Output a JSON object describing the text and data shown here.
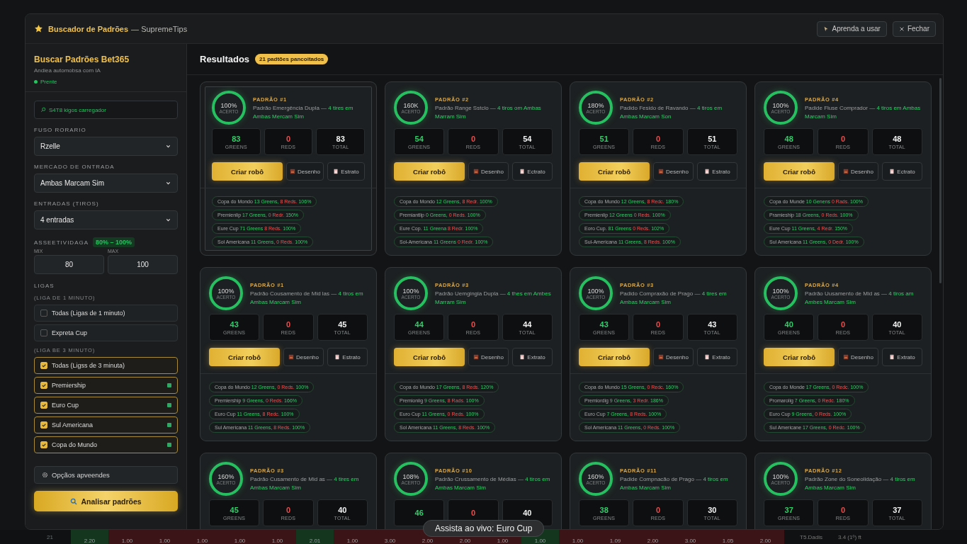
{
  "window": {
    "title": "Buscador de Padrões",
    "subtitle": "— SupremeTips",
    "buttons": [
      {
        "kind": "help",
        "label": "Aprenda a usar"
      },
      {
        "kind": "close",
        "label": "Fechar"
      }
    ]
  },
  "sidebar": {
    "title": "Buscar Padrões Bet365",
    "subtitle": "Andiea automobsa com IA",
    "status": "Prente",
    "info": "S4T8 kigos carregador",
    "fields": [
      {
        "label": "FUSO RORARIO",
        "value": "Rzelle"
      },
      {
        "label": "MERCADO DE ONTRADA",
        "value": "Ambas Marcam Sim"
      },
      {
        "label": "ENTRADAS (TIROS)",
        "value": "4 entradas"
      }
    ],
    "accuracy": {
      "label": "ASSEETIVIDAGA",
      "badge": "80% – 100%",
      "min_label": "MIX",
      "min": "80",
      "max_label": "MAX",
      "max": "100"
    },
    "leagues_title": "LIGAS",
    "groups": [
      {
        "title": "(LIGA DE 1 MINUTO)",
        "items": [
          {
            "label": "Todas (Ligas de 1 minuto)",
            "checked": false,
            "live": false
          },
          {
            "label": "Expreta Cup",
            "checked": false,
            "live": false
          }
        ]
      },
      {
        "title": "(LIGA BE 3 MINUTO)",
        "items": [
          {
            "label": "Todas (Ligss de 3 minuta)",
            "checked": true,
            "live": false
          },
          {
            "label": "Premiership",
            "checked": true,
            "live": true
          },
          {
            "label": "Euro Cup",
            "checked": true,
            "live": true
          },
          {
            "label": "Sul Americana",
            "checked": true,
            "live": true
          },
          {
            "label": "Copa do Mundo",
            "checked": true,
            "live": true
          }
        ]
      }
    ],
    "advanced": "Opçãos apveendes",
    "analyze": "Analisar padrões"
  },
  "results": {
    "title": "Resultados",
    "badge": "21 padtões pancoitados",
    "cards": [
      {
        "title": "PADRÃO #1",
        "selected": true,
        "score": "100%",
        "score_label": "ACERTO",
        "description": "Padrão Emergência Dupla",
        "market": "— 4 tires em Ambas Mercam Sim",
        "stats": [
          {
            "kind": "greens",
            "value": "83",
            "label": "GREENS"
          },
          {
            "kind": "reds",
            "value": "0",
            "label": "REDS"
          },
          {
            "kind": "total",
            "value": "83",
            "label": "TOTAL"
          }
        ],
        "actions": [
          {
            "kind": "primary",
            "label": "Criar robô"
          },
          {
            "kind": "drawing",
            "label": "Desenho"
          },
          {
            "kind": "statement",
            "label": "Estrato"
          }
        ],
        "leagues": [
          {
            "name": "Copa do Mondo",
            "greens": "13 Greens,",
            "reds": "8 Reds.",
            "rate": "106%"
          },
          {
            "name": "Premienlip",
            "greens": "17 Greens,",
            "reds": "0 Redr.",
            "rate": "150%"
          },
          {
            "name": "Eure Cup",
            "greens": "71 Greens",
            "reds": "8 Reds.",
            "rate": "100%"
          },
          {
            "name": "Sol Americana",
            "greens": "11 Greens,",
            "reds": "0 Reds.",
            "rate": "100%"
          }
        ]
      },
      {
        "title": "PADRÃO #2",
        "selected": false,
        "score": "160K",
        "score_label": "ACERTO",
        "description": "Padrão Range Sstclo",
        "market": "— 4 tiros om Ambas Marram Sim",
        "stats": [
          {
            "kind": "greens",
            "value": "54",
            "label": "GREENS"
          },
          {
            "kind": "reds",
            "value": "0",
            "label": "REDS"
          },
          {
            "kind": "total",
            "value": "54",
            "label": "TOTAL"
          }
        ],
        "actions": [
          {
            "kind": "primary",
            "label": "Criar robô"
          },
          {
            "kind": "drawing",
            "label": "Desenho"
          },
          {
            "kind": "statement",
            "label": "Ectrato"
          }
        ],
        "leagues": [
          {
            "name": "Copa do Mondo",
            "greens": "12 Greens,",
            "reds": "8 Redr.",
            "rate": "100%"
          },
          {
            "name": "Premiantlip",
            "greens": "0 Greens,",
            "reds": "0 Reds.",
            "rate": "100%"
          },
          {
            "name": "Eure Cop.",
            "greens": "11 Greena",
            "reds": "8 Redr.",
            "rate": "100%"
          },
          {
            "name": "Sol-Americana",
            "greens": "11 Greens",
            "reds": "0 Redr.",
            "rate": "100%"
          }
        ]
      },
      {
        "title": "PADRÃO #2",
        "selected": false,
        "score": "180%",
        "score_label": "ACERTO",
        "description": "Padido Fesido de Ravando",
        "market": "— 4 tiros em Ambas Marcam Son",
        "stats": [
          {
            "kind": "greens",
            "value": "51",
            "label": "GREENS"
          },
          {
            "kind": "reds",
            "value": "0",
            "label": "REDS"
          },
          {
            "kind": "total",
            "value": "51",
            "label": "TOTAL"
          }
        ],
        "actions": [
          {
            "kind": "primary",
            "label": "Criar robô"
          },
          {
            "kind": "drawing",
            "label": "Desenho"
          },
          {
            "kind": "statement",
            "label": "Estrato"
          }
        ],
        "leagues": [
          {
            "name": "Copa do Mundo",
            "greens": "12 Greens,",
            "reds": "8 Redc.",
            "rate": "180%"
          },
          {
            "name": "Premienlip",
            "greens": "12 Greens",
            "reds": "0 Reds.",
            "rate": "100%"
          },
          {
            "name": "Eoro Cup.",
            "greens": "81 Greens",
            "reds": "0 Reds.",
            "rate": "102%"
          },
          {
            "name": "Sul-Americana",
            "greens": "11 Greens,",
            "reds": "8 Reds.",
            "rate": "100%"
          }
        ]
      },
      {
        "title": "PADRÃO #4",
        "selected": false,
        "score": "100%",
        "score_label": "ACERTO",
        "description": "Padide Fluse Comprador",
        "market": "— 4 tiros em Ambas Marcam Sim",
        "stats": [
          {
            "kind": "greens",
            "value": "48",
            "label": "GREENS"
          },
          {
            "kind": "reds",
            "value": "0",
            "label": "REDS"
          },
          {
            "kind": "total",
            "value": "48",
            "label": "TOTAL"
          }
        ],
        "actions": [
          {
            "kind": "primary",
            "label": "Criar robô"
          },
          {
            "kind": "drawing",
            "label": "Desenho"
          },
          {
            "kind": "statement",
            "label": "Ectrato"
          }
        ],
        "leagues": [
          {
            "name": "Copa do Munde",
            "greens": "10 Genens",
            "reds": "0 Rads.",
            "rate": "100%"
          },
          {
            "name": "Pramieship",
            "greens": "18 Greens,",
            "reds": "0 Reds.",
            "rate": "100%"
          },
          {
            "name": "Eure Cup",
            "greens": "11 Greens,",
            "reds": "4 Redr.",
            "rate": "150%"
          },
          {
            "name": "Sul Americana",
            "greens": "11 Greens,",
            "reds": "0 Dedr.",
            "rate": "100%"
          }
        ]
      },
      {
        "title": "PADRÃO #1",
        "selected": false,
        "score": "100%",
        "score_label": "ACERTO",
        "description": "Padrão Cousamento de Mid las",
        "market": "— 4 tiros em Ambas Marcam Sim",
        "stats": [
          {
            "kind": "greens",
            "value": "43",
            "label": "GREENS"
          },
          {
            "kind": "reds",
            "value": "0",
            "label": "REDS"
          },
          {
            "kind": "total",
            "value": "45",
            "label": "TOTAL"
          }
        ],
        "actions": [
          {
            "kind": "primary",
            "label": "Criar robô"
          },
          {
            "kind": "drawing",
            "label": "Desenho"
          },
          {
            "kind": "statement",
            "label": "Estrato"
          }
        ],
        "leagues": [
          {
            "name": "Copa do Mundo",
            "greens": "12 Greens,",
            "reds": "0 Reds.",
            "rate": "100%"
          },
          {
            "name": "Premiership",
            "greens": "9 Greens,",
            "reds": "0 Reds.",
            "rate": "166%"
          },
          {
            "name": "Euro Cup",
            "greens": "11 Greens,",
            "reds": "8 Redc.",
            "rate": "100%"
          },
          {
            "name": "Sul Americana",
            "greens": "11 Greens,",
            "reds": "8 Reds.",
            "rate": "100%"
          }
        ]
      },
      {
        "title": "PADRÃO #3",
        "selected": false,
        "score": "100%",
        "score_label": "ACERTO",
        "description": "Padrão Uemgingia Dupla",
        "market": "— 4 thes em Ambes Marram Sim",
        "stats": [
          {
            "kind": "greens",
            "value": "44",
            "label": "GREENS"
          },
          {
            "kind": "reds",
            "value": "0",
            "label": "REDS"
          },
          {
            "kind": "total",
            "value": "44",
            "label": "TOTAL"
          }
        ],
        "actions": [
          {
            "kind": "primary",
            "label": "Criar robô"
          },
          {
            "kind": "drawing",
            "label": "Desenho"
          },
          {
            "kind": "statement",
            "label": "Extrato"
          }
        ],
        "leagues": [
          {
            "name": "Copa do Mundo",
            "greens": "17 Greens,",
            "reds": "8 Reds.",
            "rate": "120%"
          },
          {
            "name": "Premioniig",
            "greens": "9 Greens,",
            "reds": "8 Rads.",
            "rate": "100%"
          },
          {
            "name": "Euro Cup",
            "greens": "11 Greens,",
            "reds": "0 Reds.",
            "rate": "100%"
          },
          {
            "name": "Sol Americana",
            "greens": "11 Greens,",
            "reds": "8 Reds.",
            "rate": "100%"
          }
        ]
      },
      {
        "title": "PADRÃO #3",
        "selected": false,
        "score": "100%",
        "score_label": "ACERTO",
        "description": "Padido Compraxão de Prago",
        "market": "— 4 tires em Ambas Marcam Sim",
        "stats": [
          {
            "kind": "greens",
            "value": "43",
            "label": "GREENS"
          },
          {
            "kind": "reds",
            "value": "0",
            "label": "REDS"
          },
          {
            "kind": "total",
            "value": "43",
            "label": "TOTAL"
          }
        ],
        "actions": [
          {
            "kind": "primary",
            "label": "Criar robô"
          },
          {
            "kind": "drawing",
            "label": "Desenho"
          },
          {
            "kind": "statement",
            "label": "Extrato"
          }
        ],
        "leagues": [
          {
            "name": "Copa do Mundo",
            "greens": "15 Greens,",
            "reds": "0 Redc.",
            "rate": "160%"
          },
          {
            "name": "Premiordig",
            "greens": "9 Greens,",
            "reds": "3 Redr.",
            "rate": "186%"
          },
          {
            "name": "Euro Cup",
            "greens": "7 Greens,",
            "reds": "8 Reds.",
            "rate": "100%"
          },
          {
            "name": "Sol Americana",
            "greens": "11 Greens,",
            "reds": "0 Reds.",
            "rate": "100%"
          }
        ]
      },
      {
        "title": "PADRÃO #4",
        "selected": false,
        "score": "100%",
        "score_label": "ACERTO",
        "description": "Padrão Uusamento de Mid as",
        "market": "— 4 tiros am Ambes Marcam Sim",
        "stats": [
          {
            "kind": "greens",
            "value": "40",
            "label": "GREENS"
          },
          {
            "kind": "reds",
            "value": "0",
            "label": "REDS"
          },
          {
            "kind": "total",
            "value": "40",
            "label": "TOTAL"
          }
        ],
        "actions": [
          {
            "kind": "primary",
            "label": "Criar robô"
          },
          {
            "kind": "drawing",
            "label": "Desenho"
          },
          {
            "kind": "statement",
            "label": "Extrato"
          }
        ],
        "leagues": [
          {
            "name": "Copa do Monde",
            "greens": "17 Greens,",
            "reds": "0 Redc.",
            "rate": "100%"
          },
          {
            "name": "Promarolig",
            "greens": "7 Greens,",
            "reds": "0 Redc.",
            "rate": "180%"
          },
          {
            "name": "Euro Cup",
            "greens": "9 Greens,",
            "reds": "0 Reds.",
            "rate": "100%"
          },
          {
            "name": "Sul Americane",
            "greens": "17 Greens,",
            "reds": "0 Redc.",
            "rate": "100%"
          }
        ]
      },
      {
        "title": "PADRÃO #3",
        "selected": false,
        "score": "160%",
        "score_label": "ACERTO",
        "description": "Padrão Cusamento de Mid as",
        "market": "— 4 tires em Ambas Marcam Sim",
        "stats": [
          {
            "kind": "greens",
            "value": "45",
            "label": "GREENS"
          },
          {
            "kind": "reds",
            "value": "0",
            "label": "REDS"
          },
          {
            "kind": "total",
            "value": "40",
            "label": "TOTAL"
          }
        ]
      },
      {
        "title": "PADRÃO #10",
        "selected": false,
        "score": "108%",
        "score_label": "ACERTO",
        "description": "Padrão Crussamento de Médias",
        "market": "— 4 tiros em Ambas Marcam Sim",
        "stats": [
          {
            "kind": "greens",
            "value": "46"
          },
          {
            "kind": "reds",
            "value": "0"
          },
          {
            "kind": "total",
            "value": "40"
          }
        ]
      },
      {
        "title": "PADRÃO #11",
        "selected": false,
        "score": "160%",
        "score_label": "ACERTO",
        "description": "Padide Compnacão de Prago",
        "market": "— 4 tiros em Ambas Marcam Sim",
        "stats": [
          {
            "kind": "greens",
            "value": "38",
            "label": "GREENS"
          },
          {
            "kind": "reds",
            "value": "0",
            "label": "REDS"
          },
          {
            "kind": "total",
            "value": "30",
            "label": "TOTAL"
          }
        ]
      },
      {
        "title": "PADRÃO #12",
        "selected": false,
        "score": "100%",
        "score_label": "ACERTO",
        "description": "Padrão Zone do Soneolidação",
        "market": "— 4 tiros em Ambas Marcam Sim",
        "stats": [
          {
            "kind": "greens",
            "value": "37",
            "label": "GREENS"
          },
          {
            "kind": "reds",
            "value": "0",
            "label": "REDS"
          },
          {
            "kind": "total",
            "value": "37",
            "label": "TOTAL"
          }
        ]
      }
    ]
  },
  "toast": "Assista ao vivo: Euro Cup",
  "background_row": {
    "number": "21",
    "cells": [
      {
        "value": "2.20",
        "color": "#14361f"
      },
      {
        "value": "1.00",
        "color": "#3a1416"
      },
      {
        "value": "1.00",
        "color": "#3a1416"
      },
      {
        "value": "1.00",
        "color": "#3a1416"
      },
      {
        "value": "1.00",
        "color": "#3a1416"
      },
      {
        "value": "1.00",
        "color": "#3a1416"
      },
      {
        "value": "2.01",
        "color": "#14361f"
      },
      {
        "value": "1.00",
        "color": "#3a1416"
      },
      {
        "value": "3.00",
        "color": "#3a1416"
      },
      {
        "value": "2.00",
        "color": "#3a1416"
      },
      {
        "value": "2.00",
        "color": "#3a1416"
      },
      {
        "value": "1.00",
        "color": "#3a1416"
      },
      {
        "value": "1.00",
        "color": "#14361f"
      },
      {
        "value": "1.00",
        "color": "#3a1416"
      },
      {
        "value": "1.09",
        "color": "#3a1416"
      },
      {
        "value": "2.00",
        "color": "#3a1416"
      },
      {
        "value": "3.00",
        "color": "#3a1416"
      },
      {
        "value": "1.05",
        "color": "#3a1416"
      },
      {
        "value": "2.00",
        "color": "#3a1416"
      }
    ],
    "tail": [
      "T5.Dadis",
      "3.4 (1º) ft"
    ]
  }
}
